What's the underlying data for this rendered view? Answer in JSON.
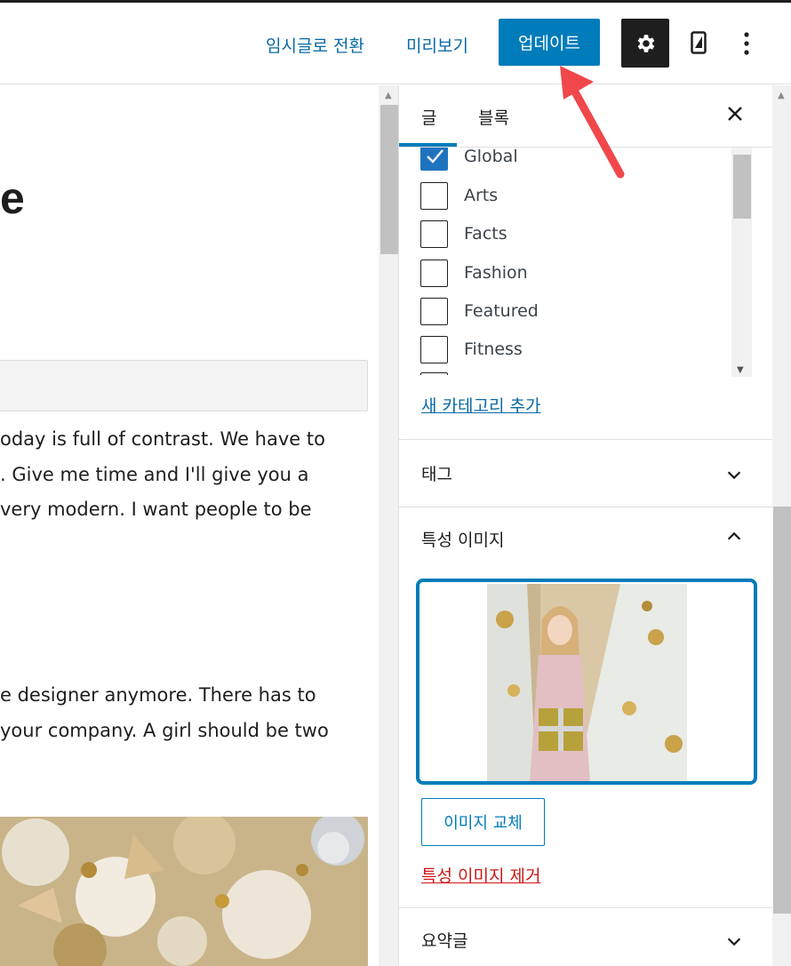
{
  "header": {
    "draft_link": "임시글로 전환",
    "preview_link": "미리보기",
    "update_button": "업데이트",
    "settings_icon": "gear-icon",
    "mobile_icon": "mobile-preview-icon",
    "more_icon": "vertical-ellipsis-icon"
  },
  "editor": {
    "title_fragment": "e",
    "paragraph1": [
      "oday is full of contrast. We have to",
      ". Give me time and I'll give you a",
      "very modern. I want people to be"
    ],
    "paragraph2": [
      "e designer anymore. There has to",
      " your company. A girl should be two"
    ]
  },
  "sidebar": {
    "tab_post": "글",
    "tab_block": "블록",
    "close_icon": "close-icon",
    "categories": [
      {
        "label": "Global",
        "checked": true
      },
      {
        "label": "Arts",
        "checked": false
      },
      {
        "label": "Facts",
        "checked": false
      },
      {
        "label": "Fashion",
        "checked": false
      },
      {
        "label": "Featured",
        "checked": false
      },
      {
        "label": "Fitness",
        "checked": false
      }
    ],
    "add_category": "새 카테고리 추가",
    "tags_title": "태그",
    "featured_title": "특성 이미지",
    "replace_image": "이미지 교체",
    "remove_image": "특성 이미지 제거",
    "excerpt_title": "요약글"
  },
  "colors": {
    "accent": "#007cba",
    "link": "#0a6aa6",
    "danger": "#cc1818",
    "annotation_arrow": "#f0474a"
  }
}
